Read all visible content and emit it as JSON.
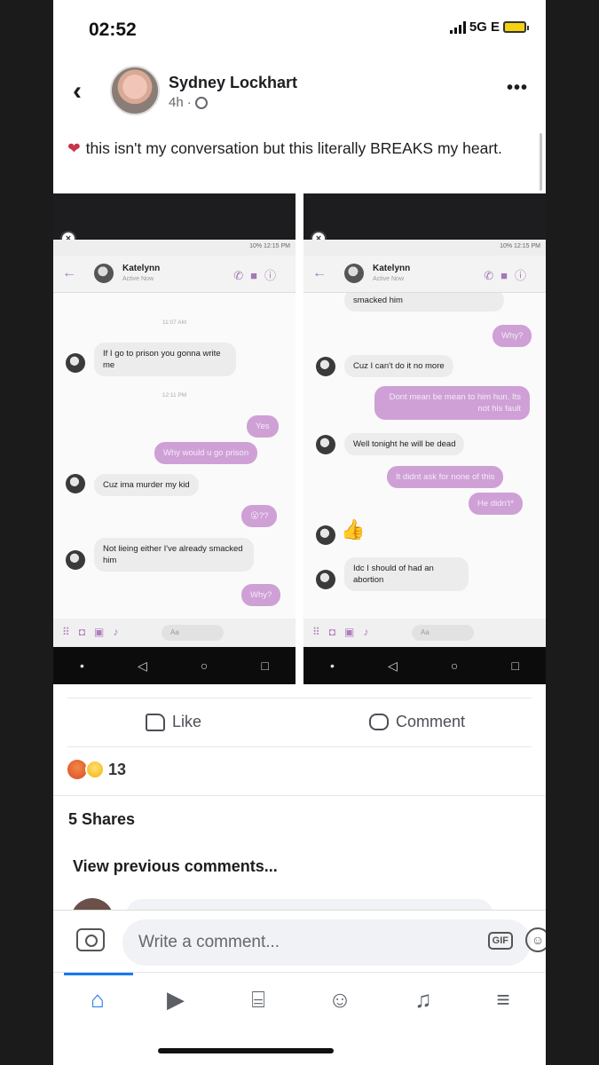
{
  "status_bar": {
    "time": "02:52",
    "network": "5G E"
  },
  "post": {
    "author": "Sydney Lockhart",
    "time": "4h",
    "caption": "this isn't my conversation but this literally BREAKS my heart."
  },
  "screenshots": {
    "status_time": "10% 12:15 PM",
    "contact": "Katelynn",
    "contact_status": "Active Now",
    "left": {
      "ts1": "11:07 AM",
      "m1": "If I go to prison you gonna write me",
      "ts2": "12:11 PM",
      "m2": "Yes",
      "m3": "Why would u go prison",
      "m4": "Cuz ima murder my kid",
      "m5": "😮??",
      "m6": "Not lieing either I've already smacked him",
      "m7": "Why?"
    },
    "right": {
      "m1": "smacked him",
      "m2": "Why?",
      "m3": "Cuz I can't do it no more",
      "m4": "Dont mean be mean to him hun. Its not his fault",
      "m5": "Well tonight he will be dead",
      "m6": "It didnt ask for none of this",
      "m7": "He didn't*",
      "m8": "Idc I should of had an abortion"
    },
    "composer_placeholder": "Aa"
  },
  "actions": {
    "like": "Like",
    "comment": "Comment"
  },
  "reactions": {
    "count": "13"
  },
  "shares": "5 Shares",
  "view_previous": "View previous comments...",
  "composer": {
    "placeholder": "Write a comment...",
    "gif": "GIF"
  }
}
